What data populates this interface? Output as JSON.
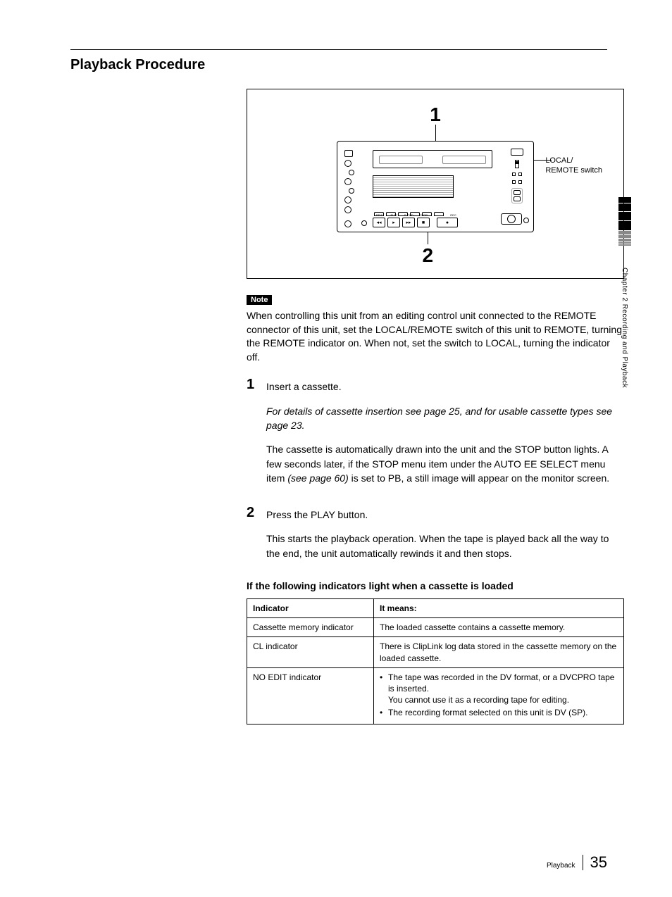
{
  "section_title": "Playback Procedure",
  "diagram": {
    "callout_1": "1",
    "callout_2": "2",
    "switch_label_1": "LOCAL/",
    "switch_label_2": "REMOTE switch",
    "transport": {
      "rew": "REW",
      "play": "PLAY",
      "ffwd": "F FWD",
      "stop": "STOP",
      "rec": "REC"
    }
  },
  "note": {
    "badge": "Note",
    "text": "When controlling this unit from an editing control unit connected to the REMOTE connector of this unit, set the LOCAL/REMOTE switch of this unit to REMOTE, turning the REMOTE indicator on. When not, set the switch to LOCAL, turning the indicator off."
  },
  "steps": [
    {
      "num": "1",
      "lead": "Insert a cassette.",
      "italic": "For details of cassette insertion see page 25, and for usable cassette types see page 23.",
      "body_pre": "The cassette is automatically drawn into the unit and the STOP button lights. A few seconds later, if the STOP menu item under the AUTO EE SELECT menu item ",
      "body_ital": "(see page 60)",
      "body_post": " is set to PB, a still image will appear on the monitor screen."
    },
    {
      "num": "2",
      "lead": "Press the PLAY button.",
      "body": "This starts the playback operation. When the tape is played back all the way to the end, the unit automatically rewinds it and then stops."
    }
  ],
  "subhead": "If the following indicators light when a cassette is loaded",
  "table": {
    "head": {
      "c1": "Indicator",
      "c2": "It means:"
    },
    "rows": [
      {
        "c1": "Cassette memory indicator",
        "c2": "The loaded cassette contains a cassette memory."
      },
      {
        "c1": "CL indicator",
        "c2": "There is ClipLink log data stored in the cassette memory on the loaded cassette."
      },
      {
        "c1": "NO EDIT indicator",
        "bullets": [
          "The tape was recorded in the DV format, or a DVCPRO tape is inserted.\nYou cannot use it as a recording tape for editing.",
          "The recording format selected on this unit is DV (SP)."
        ]
      }
    ]
  },
  "side_text": "Chapter 2    Recording and Playback",
  "footer": {
    "label": "Playback",
    "page": "35"
  }
}
